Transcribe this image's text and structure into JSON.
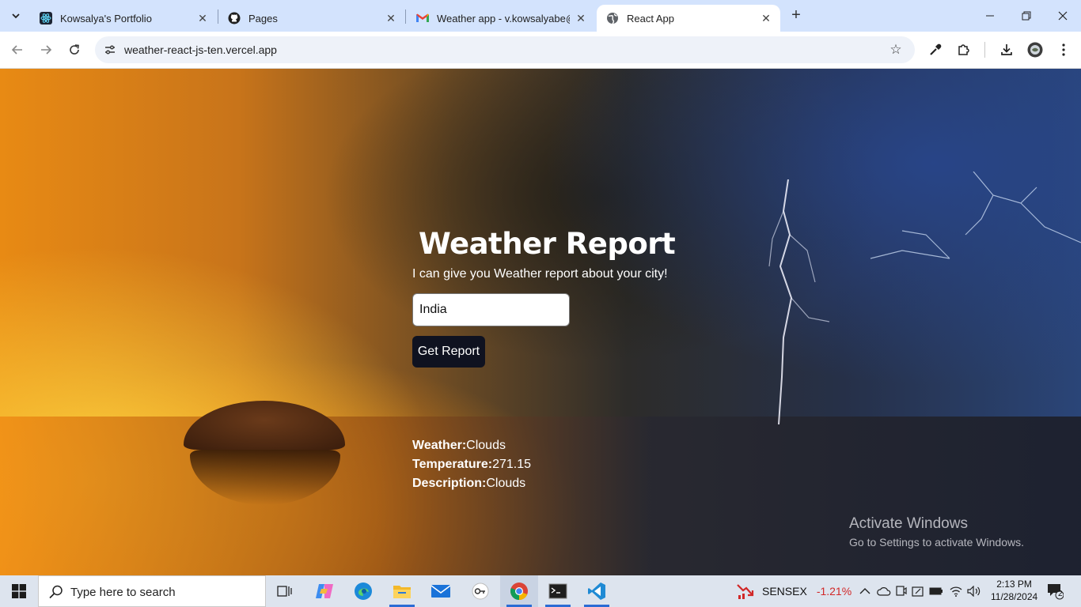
{
  "browser": {
    "tabs": [
      {
        "title": "Kowsalya's Portfolio",
        "icon": "react-icon",
        "active": false
      },
      {
        "title": "Pages",
        "icon": "github-icon",
        "active": false
      },
      {
        "title": "Weather app - v.kowsalyabe@g",
        "icon": "gmail-icon",
        "active": false
      },
      {
        "title": "React App",
        "icon": "globe-icon",
        "active": true
      }
    ],
    "url": "weather-react-js-ten.vercel.app"
  },
  "page": {
    "heading": "Weather Report",
    "subtitle": "I can give you Weather report about your city!",
    "city_input_value": "India",
    "button_label": "Get Report",
    "results": {
      "weather_label": "Weather:",
      "weather_value": "Clouds",
      "temperature_label": "Temperature:",
      "temperature_value": "271.15",
      "description_label": "Description:",
      "description_value": "Clouds"
    },
    "watermark": {
      "line1": "Activate Windows",
      "line2": "Go to Settings to activate Windows."
    }
  },
  "taskbar": {
    "search_placeholder": "Type here to search",
    "stock_name": "SENSEX",
    "stock_change": "-1.21%",
    "time": "2:13 PM",
    "date": "11/28/2024",
    "notification_count": "2"
  },
  "colors": {
    "tab_strip": "#d3e3fd",
    "button_bg": "#0f1220",
    "stock_negative": "#d12828"
  }
}
